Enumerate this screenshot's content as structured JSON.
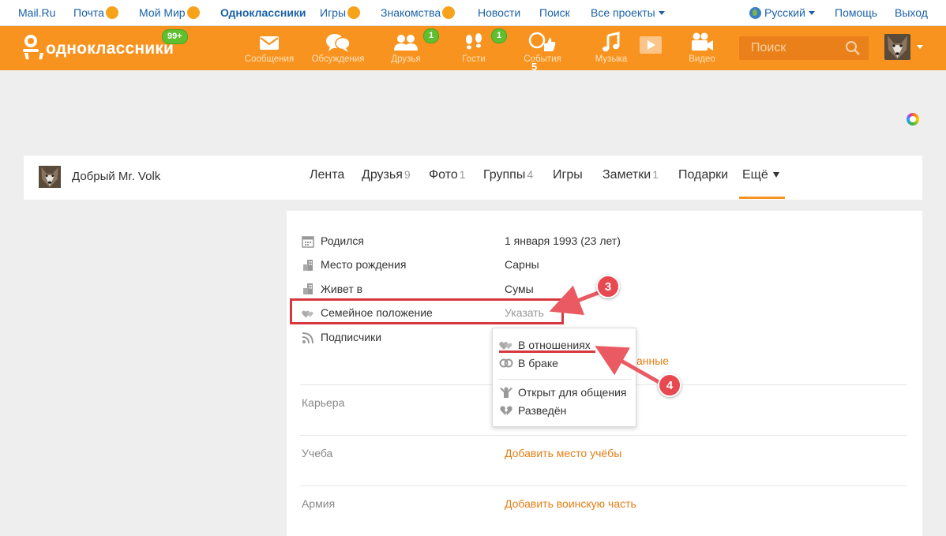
{
  "topbar": {
    "links": [
      "Mail.Ru",
      "Почта",
      "Мой Мир",
      "Одноклассники",
      "Игры",
      "Знакомства",
      "Новости",
      "Поиск",
      "Все проекты"
    ],
    "language": "Русский",
    "help": "Помощь",
    "logout": "Выход"
  },
  "header": {
    "logo_text": "одноклассники",
    "logo_badge": "99+",
    "nav": [
      {
        "label": "Сообщения",
        "icon": "envelope-icon"
      },
      {
        "label": "Обсуждения",
        "icon": "chat-bubbles-icon"
      },
      {
        "label": "Друзья",
        "icon": "friends-icon",
        "badge": "1"
      },
      {
        "label": "Гости",
        "icon": "footprints-icon",
        "badge": "1"
      },
      {
        "label": "События",
        "icon": "events-icon",
        "badge": "5"
      },
      {
        "label": "Музыка",
        "icon": "music-note-icon"
      },
      {
        "label": "",
        "icon": "play-icon"
      },
      {
        "label": "Видео",
        "icon": "video-camera-icon"
      }
    ],
    "search_placeholder": "Поиск"
  },
  "profile": {
    "name": "Добрый Mr. Volk",
    "tabs": [
      {
        "label": "Лента",
        "count": ""
      },
      {
        "label": "Друзья",
        "count": "9"
      },
      {
        "label": "Фото",
        "count": "1"
      },
      {
        "label": "Группы",
        "count": "4"
      },
      {
        "label": "Игры",
        "count": ""
      },
      {
        "label": "Заметки",
        "count": "1"
      },
      {
        "label": "Подарки",
        "count": ""
      },
      {
        "label": "Ещё",
        "count": ""
      }
    ]
  },
  "info": {
    "rows": [
      {
        "label": "Родился",
        "value": "1 января 1993 (23 лет)"
      },
      {
        "label": "Место рождения",
        "value": "Сарны"
      },
      {
        "label": "Живет в",
        "value": "Сумы"
      },
      {
        "label": "Семейное положение",
        "value": "Указать"
      },
      {
        "label": "Подписчики",
        "value": ""
      }
    ],
    "peek_link": "анные",
    "sections": [
      {
        "label": "Карьера",
        "value": ""
      },
      {
        "label": "Учеба",
        "value": "Добавить место учёбы"
      },
      {
        "label": "Армия",
        "value": "Добавить воинскую часть"
      }
    ]
  },
  "dropdown": {
    "items": [
      "В отношениях",
      "В браке",
      "Открыт для общения",
      "Разведён"
    ]
  },
  "annotations": {
    "step3": "3",
    "step4": "4"
  },
  "colors": {
    "brand_orange": "#f7931e",
    "link_blue": "#1a61a8",
    "highlight_red": "#d6383d"
  }
}
